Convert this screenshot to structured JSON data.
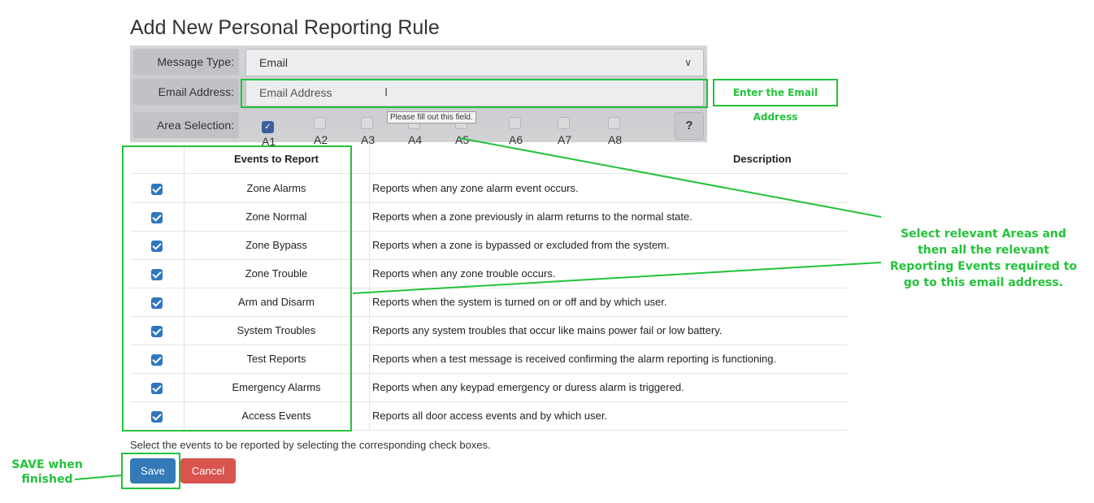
{
  "page": {
    "title": "Add New Personal Reporting Rule"
  },
  "form": {
    "message_type": {
      "label": "Message Type:",
      "value": "Email"
    },
    "email_address": {
      "label": "Email Address:",
      "placeholder": "Email Address",
      "tooltip": "Please fill out this field."
    },
    "area_selection": {
      "label": "Area Selection:",
      "areas": [
        {
          "name": "A1",
          "checked": true
        },
        {
          "name": "A2",
          "checked": false
        },
        {
          "name": "A3",
          "checked": false
        },
        {
          "name": "A4",
          "checked": false
        },
        {
          "name": "A5",
          "checked": false
        },
        {
          "name": "A6",
          "checked": false
        },
        {
          "name": "A7",
          "checked": false
        },
        {
          "name": "A8",
          "checked": false
        }
      ],
      "help_label": "?"
    }
  },
  "table": {
    "headers": {
      "event": "Events to Report",
      "description": "Description"
    },
    "rows": [
      {
        "event": "Zone Alarms",
        "description": "Reports when any zone alarm event occurs.",
        "checked": true
      },
      {
        "event": "Zone Normal",
        "description": "Reports when a zone previously in alarm returns to the normal state.",
        "checked": true
      },
      {
        "event": "Zone Bypass",
        "description": "Reports when a zone is bypassed or excluded from the system.",
        "checked": true
      },
      {
        "event": "Zone Trouble",
        "description": "Reports when any zone trouble occurs.",
        "checked": true
      },
      {
        "event": "Arm and Disarm",
        "description": "Reports when the system is turned on or off and by which user.",
        "checked": true
      },
      {
        "event": "System Troubles",
        "description": "Reports any system troubles that occur like mains power fail or low battery.",
        "checked": true
      },
      {
        "event": "Test Reports",
        "description": "Reports when a test message is received confirming the alarm reporting is functioning.",
        "checked": true
      },
      {
        "event": "Emergency Alarms",
        "description": "Reports when any keypad emergency or duress alarm is triggered.",
        "checked": true
      },
      {
        "event": "Access Events",
        "description": "Reports all door access events and by which user.",
        "checked": true
      }
    ]
  },
  "help_text": "Select the events to be reported by selecting the corresponding check boxes.",
  "buttons": {
    "save": "Save",
    "cancel": "Cancel"
  },
  "annotations": {
    "email_callout": "Enter the Email Address",
    "areas_callout": "Select relevant Areas and then all the relevant Reporting Events required to go to this email address.",
    "save_callout": "SAVE when finished",
    "accent_color": "#22c33a"
  }
}
